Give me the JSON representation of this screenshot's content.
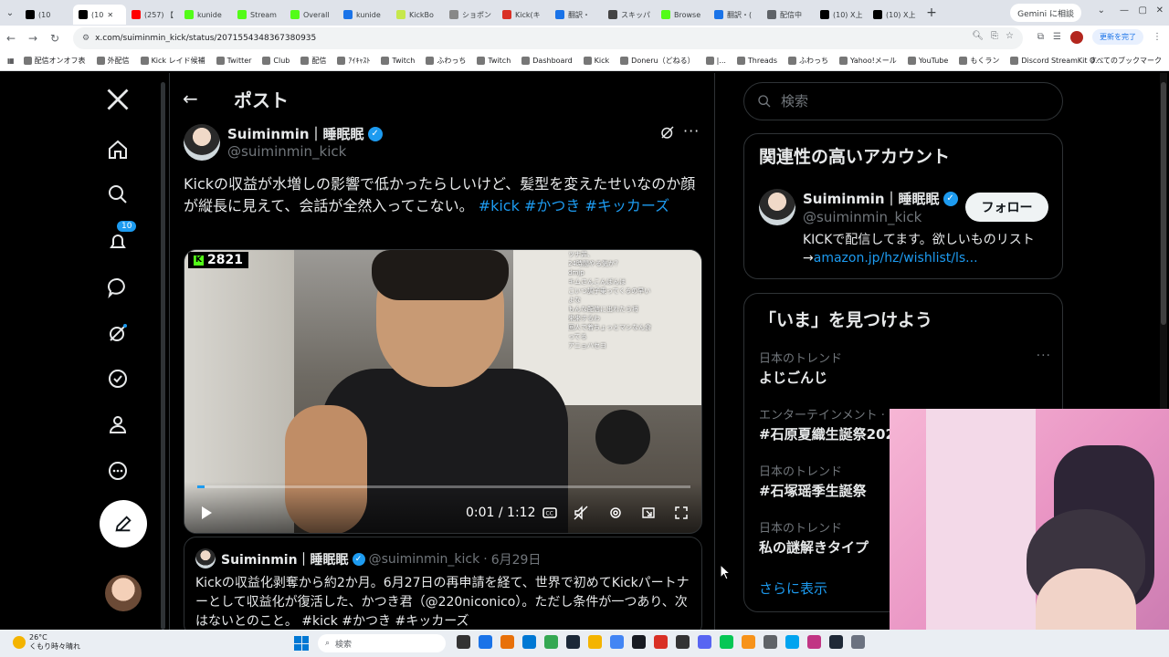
{
  "browser": {
    "tabs": [
      {
        "label": "(10",
        "color": "#000000"
      },
      {
        "label": "(10",
        "color": "#000000",
        "active": true
      },
      {
        "label": "(257) 【",
        "color": "#ff0000"
      },
      {
        "label": "kunide",
        "color": "#53fc18"
      },
      {
        "label": "Stream",
        "color": "#53fc18"
      },
      {
        "label": "Overall",
        "color": "#53fc18"
      },
      {
        "label": "kunide",
        "color": "#1a73e8"
      },
      {
        "label": "KickBo",
        "color": "#c6e84c"
      },
      {
        "label": "ショポン",
        "color": "#888888"
      },
      {
        "label": "Kick(キ",
        "color": "#d93025"
      },
      {
        "label": "翻訳・",
        "color": "#1a73e8"
      },
      {
        "label": "スキッパ",
        "color": "#444444"
      },
      {
        "label": "Browse",
        "color": "#53fc18"
      },
      {
        "label": "翻訳・(",
        "color": "#1a73e8"
      },
      {
        "label": "配信中",
        "color": "#5f6368"
      },
      {
        "label": "(10) X上",
        "color": "#000000"
      },
      {
        "label": "(10) X上",
        "color": "#000000"
      }
    ],
    "gemini_label": "Gemini に相談",
    "url": "x.com/suiminmin_kick/status/2071554348367380935",
    "update_label": "更新を完了",
    "bookmarks": [
      "配信オンオフ表",
      "外配信",
      "Kick レイド候補",
      "Twitter",
      "Club",
      "配信",
      "ｱｲｷｬｽﾄ",
      "Twitch",
      "ふわっち",
      "Twitch",
      "Dashboard",
      "Kick",
      "Doneru（どねる）",
      "|...",
      "Threads",
      "ふわっち",
      "Yahoo!メール",
      "YouTube",
      "もくラン",
      "Discord StreamKit O..."
    ],
    "all_bookmarks": "すべてのブックマーク"
  },
  "nav": {
    "notification_count": "10"
  },
  "header": {
    "title": "ポスト"
  },
  "post": {
    "author_name": "Suiminmin｜睡眠眠",
    "author_handle": "@suiminmin_kick",
    "text_main": "Kickの収益が水増しの影響で低かったらしいけど、髪型を変えたせいなのか顔が縦長に見えて、会話が全然入ってこない。 ",
    "hashtags": [
      "#kick",
      "#かつき",
      "#キッカーズ"
    ],
    "video": {
      "viewer_count": "2821",
      "time": "0:01 / 1:12",
      "progress": 0.014,
      "chat": [
        "ツナ丼、",
        "24時間やる気か？",
        "dmjp",
        "キムさんこんばんは",
        "こいつ調子乗ってくるの早い",
        "よな",
        "もんな配信に出れたら将",
        "来来するわ",
        "回人で着ちょっとマシなん食",
        "ってる",
        "アニョハセヨ"
      ]
    },
    "quoted": {
      "author_name": "Suiminmin｜睡眠眠",
      "author_handle": "@suiminmin_kick",
      "date": "6月29日",
      "text": "Kickの収益化剥奪から約2か月。6月27日の再申請を経て、世界で初めてKickパートナーとして収益化が復活した、かつき君（@220niconico）。ただし条件が一つあり、次はないとのこと。 #kick #かつき #キッカーズ"
    }
  },
  "search": {
    "placeholder": "検索"
  },
  "related": {
    "title": "関連性の高いアカウント",
    "name": "Suiminmin｜睡眠眠",
    "handle": "@suiminmin_kick",
    "follow_label": "フォロー",
    "bio": "KICKで配信してます。欲しいものリスト→",
    "bio_link": "amazon.jp/hz/wishlist/ls..."
  },
  "trends": {
    "title": "「いま」を見つけよう",
    "items": [
      {
        "category": "日本のトレンド",
        "name": "よじごんじ"
      },
      {
        "category": "エンターテインメント · トレンド",
        "name": "#石原夏織生誕祭2026"
      },
      {
        "category": "日本のトレンド",
        "name": "#石塚瑶季生誕祭"
      },
      {
        "category": "日本のトレンド",
        "name": "私の謎解きタイプ"
      }
    ],
    "show_more": "さらに表示"
  },
  "taskbar": {
    "temperature": "26°C",
    "weather": "くもり時々晴れ",
    "search_label": "検索",
    "app_colors": [
      "#333333",
      "#1a73e8",
      "#e8710a",
      "#0078d4",
      "#34a853",
      "#1b2838",
      "#f4b400",
      "#4285f4",
      "#171a21",
      "#d93025",
      "#333333",
      "#5865f2",
      "#06c755",
      "#f7931a",
      "#5f6368",
      "#00a4ef",
      "#c13584",
      "#1f2937",
      "#6b7280"
    ]
  }
}
